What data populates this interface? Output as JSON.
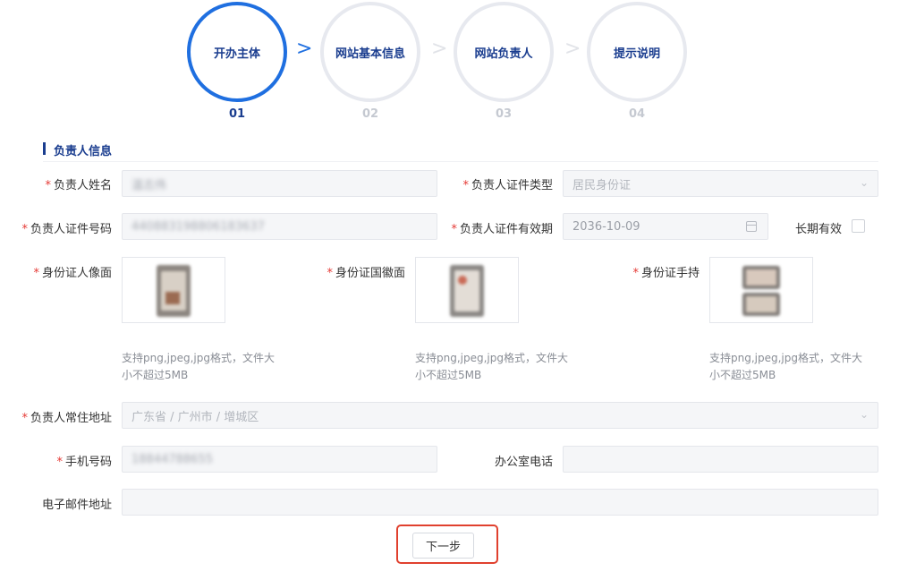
{
  "steps": [
    {
      "label": "开办主体",
      "num": "01"
    },
    {
      "label": "网站基本信息",
      "num": "02"
    },
    {
      "label": "网站负责人",
      "num": "03"
    },
    {
      "label": "提示说明",
      "num": "04"
    }
  ],
  "step_separator": ">",
  "section": {
    "title": "负责人信息"
  },
  "required_mark": "*",
  "form": {
    "name": {
      "label": "负责人姓名",
      "value": "温志伟"
    },
    "id_type": {
      "label": "负责人证件类型",
      "value": "居民身份证"
    },
    "id_number": {
      "label": "负责人证件号码",
      "value": "440883198806183637"
    },
    "id_expiry": {
      "label": "负责人证件有效期",
      "value": "2036-10-09"
    },
    "long_term": {
      "label": "长期有效"
    },
    "id_front": {
      "label": "身份证人像面"
    },
    "id_back": {
      "label": "身份证国徽面"
    },
    "id_hold": {
      "label": "身份证手持"
    },
    "upload_hint_line1": "支持png,jpeg,jpg格式，文件大",
    "upload_hint_line2": "小不超过5MB",
    "address": {
      "label": "负责人常住地址",
      "value": "广东省 / 广州市 / 增城区"
    },
    "mobile": {
      "label": "手机号码",
      "value": "18844788655"
    },
    "office_phone": {
      "label": "办公室电话",
      "value": ""
    },
    "email": {
      "label": "电子邮件地址",
      "value": ""
    }
  },
  "next_button": {
    "label": "下一步"
  },
  "colors": {
    "primary": "#1f6fe0",
    "heading": "#1a3d8f",
    "required": "#e53935",
    "highlight": "#e0402e"
  },
  "icons": {
    "dropdown": "chevron-down-icon",
    "calendar": "calendar-icon"
  }
}
